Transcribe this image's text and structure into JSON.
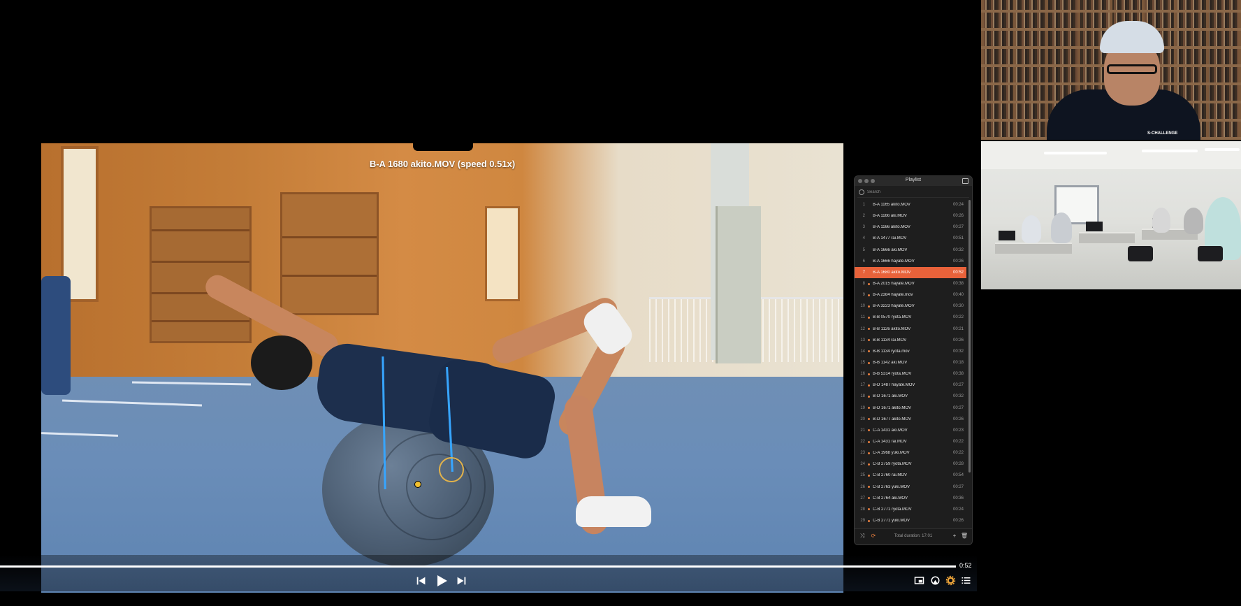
{
  "video": {
    "title": "B-A 1680 akito.MOV (speed 0.51x)"
  },
  "controls": {
    "time": "0:52",
    "progress_fraction": 1.0
  },
  "playlist": {
    "title": "Playlist",
    "search_placeholder": "Search",
    "total_duration": "Total duration: 17:01",
    "active_index": 6,
    "items": [
      {
        "num": "1",
        "name": "B-A 1165 akito.MOV",
        "dur": "00:24",
        "bullet": false
      },
      {
        "num": "2",
        "name": "B-A 1166 aki.MOV",
        "dur": "00:26",
        "bullet": false
      },
      {
        "num": "3",
        "name": "B-A 1166 akito.MOV",
        "dur": "00:27",
        "bullet": false
      },
      {
        "num": "4",
        "name": "B-A 1477 rai.MOV",
        "dur": "00:51",
        "bullet": false
      },
      {
        "num": "5",
        "name": "B-A 1666 aki.MOV",
        "dur": "00:32",
        "bullet": false
      },
      {
        "num": "6",
        "name": "B-A 1666 hayate.MOV",
        "dur": "00:26",
        "bullet": false
      },
      {
        "num": "7",
        "name": "B-A 1680 akito.MOV",
        "dur": "00:52",
        "bullet": false
      },
      {
        "num": "8",
        "name": "B-A 2015 hayate.MOV",
        "dur": "00:38",
        "bullet": true
      },
      {
        "num": "9",
        "name": "B-A 2384 hayate.mov",
        "dur": "00:40",
        "bullet": true
      },
      {
        "num": "10",
        "name": "B-A 3223 hayate.MOV",
        "dur": "00:30",
        "bullet": true
      },
      {
        "num": "11",
        "name": "B-B 0570 ryota.MOV",
        "dur": "00:22",
        "bullet": true
      },
      {
        "num": "12",
        "name": "B-B 1126 akito.MOV",
        "dur": "00:21",
        "bullet": true
      },
      {
        "num": "13",
        "name": "B-B 1134 rai.MOV",
        "dur": "00:26",
        "bullet": true
      },
      {
        "num": "14",
        "name": "B-B 1134 ryota.mov",
        "dur": "00:32",
        "bullet": true
      },
      {
        "num": "15",
        "name": "B-B 1142 aki.MOV",
        "dur": "00:18",
        "bullet": true
      },
      {
        "num": "16",
        "name": "B-B 5314 ryota.MOV",
        "dur": "00:38",
        "bullet": true
      },
      {
        "num": "17",
        "name": "B-D 1487 hayate.MOV",
        "dur": "00:27",
        "bullet": true
      },
      {
        "num": "18",
        "name": "B-D 1671 aki.MOV",
        "dur": "00:32",
        "bullet": true
      },
      {
        "num": "19",
        "name": "B-D 1671 akito.MOV",
        "dur": "00:27",
        "bullet": true
      },
      {
        "num": "20",
        "name": "B-D 1677 akito.MOV",
        "dur": "00:26",
        "bullet": true
      },
      {
        "num": "21",
        "name": "C-A 1431 aki.MOV",
        "dur": "00:23",
        "bullet": true
      },
      {
        "num": "22",
        "name": "C-A 1431 rai.MOV",
        "dur": "00:22",
        "bullet": true
      },
      {
        "num": "23",
        "name": "C-A 1968 yuki.MOV",
        "dur": "00:22",
        "bullet": true
      },
      {
        "num": "24",
        "name": "C-B 2759 ryota.MOV",
        "dur": "00:28",
        "bullet": true
      },
      {
        "num": "25",
        "name": "C-B 2760 rai.MOV",
        "dur": "00:54",
        "bullet": true
      },
      {
        "num": "26",
        "name": "C-B 2763 yuki.MOV",
        "dur": "00:27",
        "bullet": true
      },
      {
        "num": "27",
        "name": "C-B 2764 aki.MOV",
        "dur": "00:36",
        "bullet": true
      },
      {
        "num": "28",
        "name": "C-B 2771 ryota.MOV",
        "dur": "00:24",
        "bullet": true
      },
      {
        "num": "29",
        "name": "C-B 2771 yuki.MOV",
        "dur": "00:26",
        "bullet": true
      }
    ]
  },
  "webcam": {
    "shirt_logo": "S-CHALLENGE"
  },
  "icons": {
    "prev": "skip-back-icon",
    "play": "play-icon",
    "next": "skip-forward-icon",
    "pip": "picture-in-picture-icon",
    "airplay": "airplay-icon",
    "settings": "gear-icon",
    "playlist": "list-icon",
    "shuffle": "shuffle-icon",
    "repeat": "repeat-icon",
    "add": "plus-icon",
    "delete": "trash-icon"
  },
  "colors": {
    "accent": "#e8623a",
    "settings_icon": "#f0a63a",
    "tracker": "#37a5ff"
  }
}
